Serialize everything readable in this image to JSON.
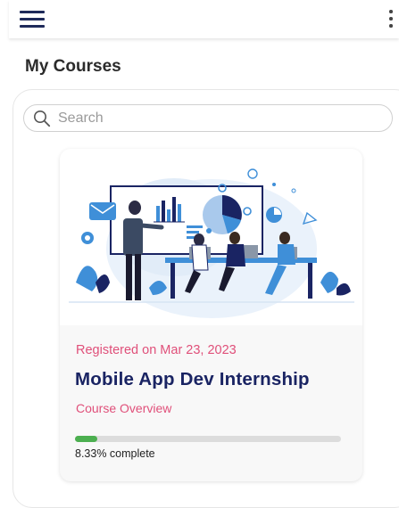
{
  "header": {
    "menu_icon": "hamburger-menu-icon",
    "more_icon": "more-vertical-icon"
  },
  "page": {
    "title": "My Courses"
  },
  "search": {
    "placeholder": "Search",
    "icon": "search-icon"
  },
  "courses": [
    {
      "registered_label": "Registered on Mar 23, 2023",
      "title": "Mobile App Dev Internship",
      "overview_link": "Course Overview",
      "progress_fraction": 0.0833,
      "progress_label": "8.33% complete"
    }
  ],
  "colors": {
    "accent_pink": "#e0507a",
    "title_navy": "#1a2463",
    "progress_green": "#4caf50",
    "illustration_blue": "#3f8fd8"
  }
}
